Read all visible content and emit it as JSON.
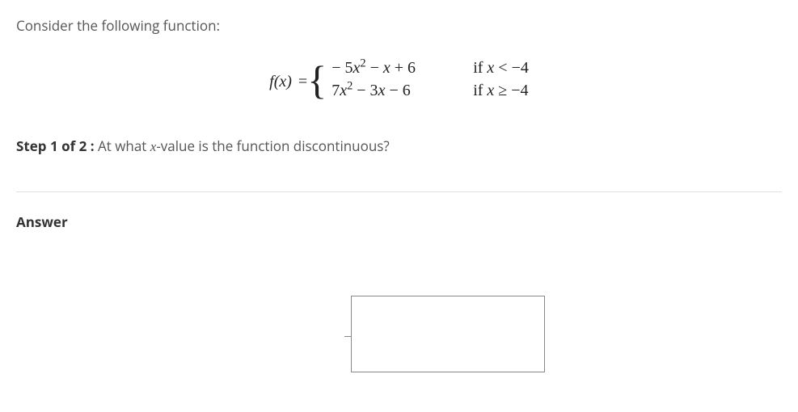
{
  "intro": "Consider the following function:",
  "math": {
    "prefix_fx": "f(x)",
    "equals": " = ",
    "case1_expr_parts": [
      "− 5",
      "x",
      "2",
      " − ",
      "x",
      " + 6"
    ],
    "case1_cond_parts": [
      "if ",
      "x",
      " < −4"
    ],
    "case2_expr_parts": [
      "7",
      "x",
      "2",
      " − 3",
      "x",
      " − 6"
    ],
    "case2_cond_parts": [
      "if ",
      "x",
      " ≥ −4"
    ]
  },
  "step": {
    "bold": "Step 1 of 2 :",
    "before_x": "  At what ",
    "x": "x",
    "after_x": "-value is the function discontinuous?"
  },
  "answer_label": "Answer",
  "answer_value": ""
}
